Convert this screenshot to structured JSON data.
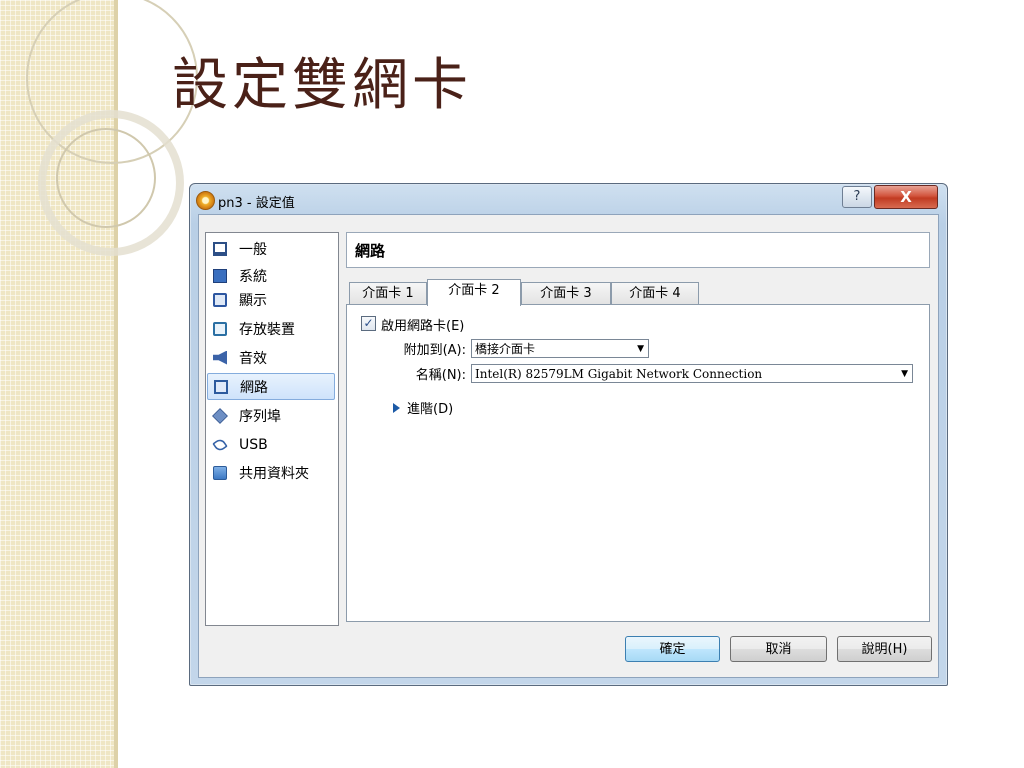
{
  "slide": {
    "title": "設定雙網卡"
  },
  "dialog": {
    "title": "pn3 - 設定值",
    "help_label": "?",
    "close_label": "X",
    "sidebar": {
      "items": [
        {
          "label": "一般",
          "icon": "general-icon"
        },
        {
          "label": "系統",
          "icon": "system-icon"
        },
        {
          "label": "顯示",
          "icon": "display-icon"
        },
        {
          "label": "存放裝置",
          "icon": "storage-icon"
        },
        {
          "label": "音效",
          "icon": "audio-icon"
        },
        {
          "label": "網路",
          "icon": "network-icon",
          "selected": true
        },
        {
          "label": "序列埠",
          "icon": "serial-port-icon"
        },
        {
          "label": "USB",
          "icon": "usb-icon"
        },
        {
          "label": "共用資料夾",
          "icon": "shared-folder-icon"
        }
      ]
    },
    "page_title": "網路",
    "tabs": [
      {
        "label": "介面卡 1"
      },
      {
        "label": "介面卡 2",
        "active": true
      },
      {
        "label": "介面卡 3"
      },
      {
        "label": "介面卡 4"
      }
    ],
    "adapter": {
      "enable_label": "啟用網路卡(E)",
      "enable_checked": true,
      "attached_label": "附加到(A):",
      "attached_value": "橋接介面卡",
      "name_label": "名稱(N):",
      "name_value": "Intel(R) 82579LM Gigabit Network Connection",
      "advanced_label": "進階(D)"
    },
    "buttons": {
      "ok": "確定",
      "cancel": "取消",
      "help": "說明(H)"
    }
  }
}
